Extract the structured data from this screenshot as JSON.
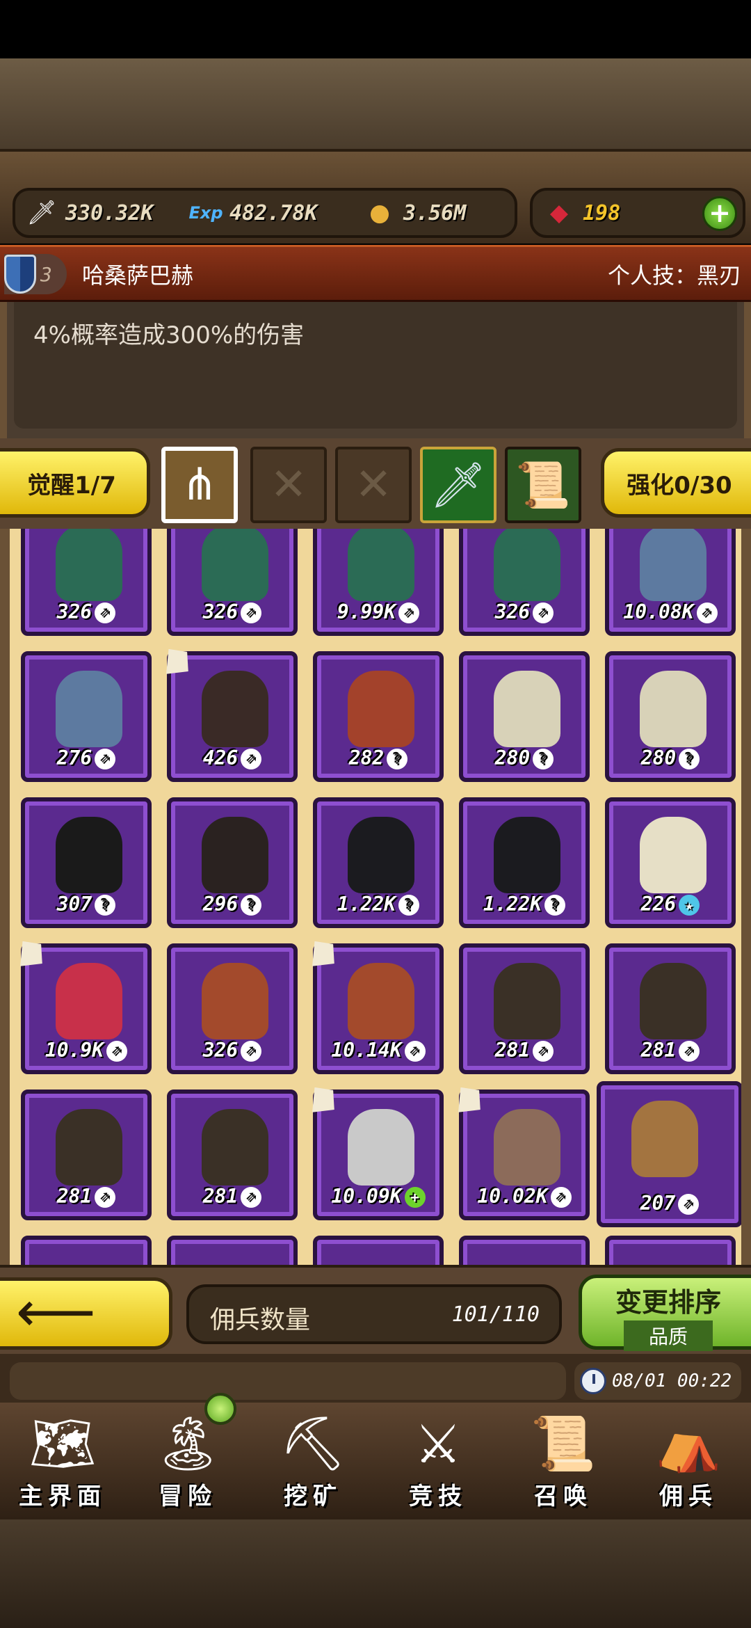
{
  "resources": {
    "attack": "330.32K",
    "exp": "482.78K",
    "gold": "3.56M",
    "gems": "198",
    "exp_icon_label": "Exp"
  },
  "hero": {
    "rank": "3",
    "name": "哈桑萨巴赫",
    "skill": "个人技：黑刃",
    "description": "4%概率造成300%的伤害"
  },
  "awaken": {
    "awaken_label": "觉醒1/7",
    "enhance_label": "强化0/30"
  },
  "mercenaries": [
    {
      "level": "326",
      "badge": "arrow"
    },
    {
      "level": "326",
      "badge": "arrow"
    },
    {
      "level": "9.99K",
      "badge": "arrow"
    },
    {
      "level": "326",
      "badge": "arrow"
    },
    {
      "level": "10.08K",
      "badge": "arrow"
    },
    {
      "level": "276",
      "badge": "arrow"
    },
    {
      "level": "426",
      "badge": "arrow"
    },
    {
      "level": "282",
      "badge": "question"
    },
    {
      "level": "280",
      "badge": "question"
    },
    {
      "level": "280",
      "badge": "question"
    },
    {
      "level": "307",
      "badge": "question"
    },
    {
      "level": "296",
      "badge": "question"
    },
    {
      "level": "1.22K",
      "badge": "question"
    },
    {
      "level": "1.22K",
      "badge": "question"
    },
    {
      "level": "226",
      "badge": "star"
    },
    {
      "level": "10.9K",
      "badge": "arrow"
    },
    {
      "level": "326",
      "badge": "arrow"
    },
    {
      "level": "10.14K",
      "badge": "arrow"
    },
    {
      "level": "281",
      "badge": "arrow"
    },
    {
      "level": "281",
      "badge": "arrow"
    },
    {
      "level": "281",
      "badge": "arrow"
    },
    {
      "level": "281",
      "badge": "arrow"
    },
    {
      "level": "10.09K",
      "badge": "plus"
    },
    {
      "level": "10.02K",
      "badge": "arrow"
    },
    {
      "level": "207",
      "badge": "arrow"
    }
  ],
  "footer": {
    "count_label": "佣兵数量",
    "count_value": "101/110",
    "sort_title": "变更排序",
    "sort_sub": "品质",
    "datetime": "08/01 00:22"
  },
  "nav": [
    {
      "label": "主界面",
      "icon": "map-scroll-icon"
    },
    {
      "label": "冒险",
      "icon": "island-icon"
    },
    {
      "label": "挖矿",
      "icon": "pickaxe-icon"
    },
    {
      "label": "竞技",
      "icon": "crossed-swords-icon"
    },
    {
      "label": "召唤",
      "icon": "summon-scroll-icon"
    },
    {
      "label": "佣兵",
      "icon": "tent-icon"
    }
  ]
}
